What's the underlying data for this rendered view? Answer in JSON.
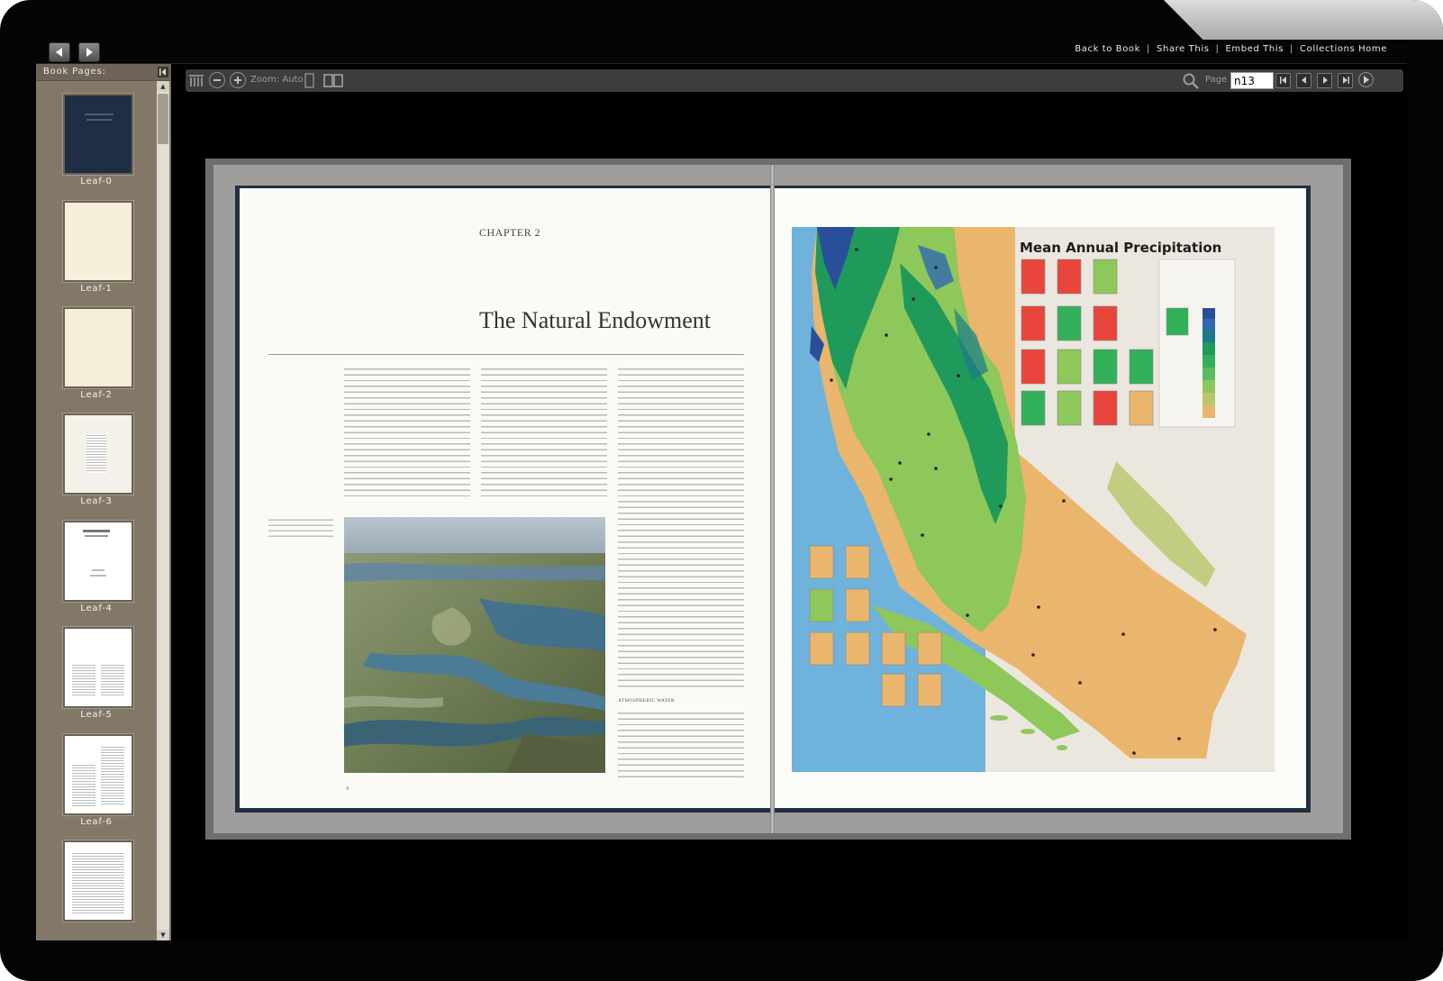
{
  "topbar": {
    "links": [
      "Back to Book",
      "Share This",
      "Embed This",
      "Collections Home"
    ],
    "separator": "|"
  },
  "sidebar": {
    "title": "Book Pages:",
    "leaves": [
      "Leaf-0",
      "Leaf-1",
      "Leaf-2",
      "Leaf-3",
      "Leaf-4",
      "Leaf-5",
      "Leaf-6"
    ]
  },
  "toolbar": {
    "zoom_label": "Zoom: Auto",
    "page_label": "Page",
    "page_value": "n13"
  },
  "book": {
    "left_page": {
      "chapter": "CHAPTER 2",
      "title": "The Natural Endowment",
      "subhead": "ATMOSPHERIC WATER"
    },
    "right_page": {
      "map_title": "Mean Annual Precipitation"
    }
  },
  "colors": {
    "frame": "#040404",
    "sidebar": "#837868",
    "toolbar": "#3d3d3d",
    "map_ocean": "#6fb3dc",
    "map_dry": "#eab56c",
    "map_mid": "#8ec75a",
    "map_wet": "#1f9a5a"
  }
}
